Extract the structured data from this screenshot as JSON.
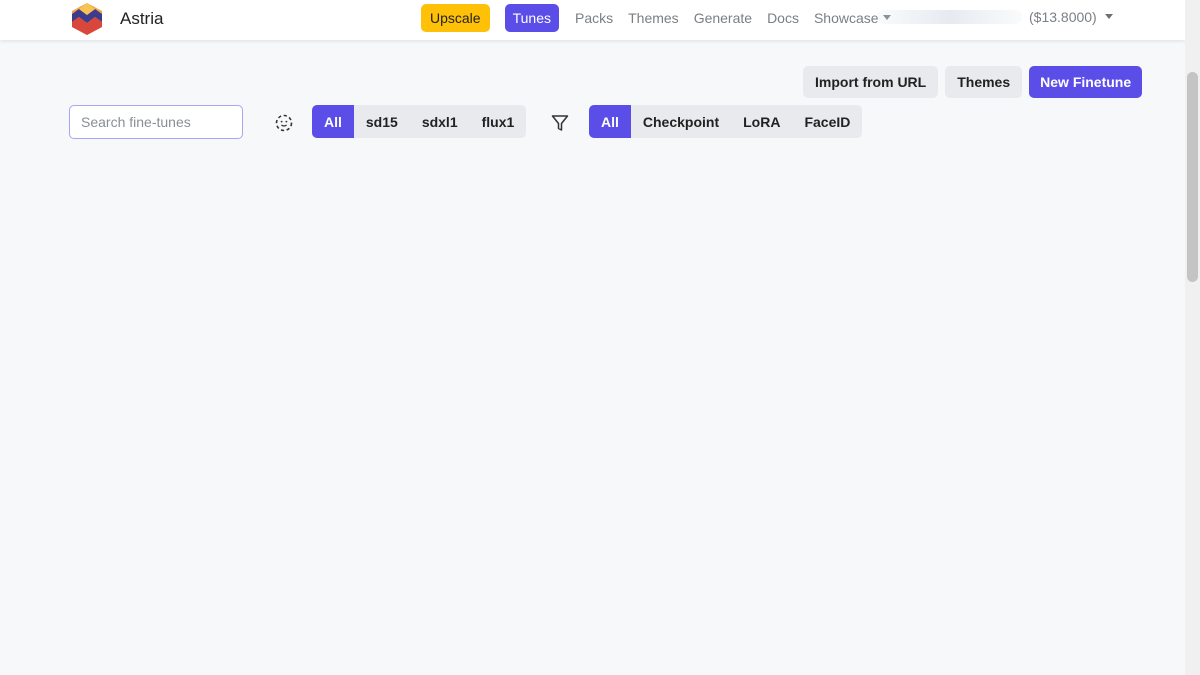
{
  "header": {
    "brand_name": "Astria",
    "upscale_label": "Upscale",
    "tunes_label": "Tunes",
    "nav_links": [
      "Packs",
      "Themes",
      "Generate",
      "Docs",
      "Showcase"
    ],
    "balance": "($13.8000)"
  },
  "actions": {
    "import_label": "Import from URL",
    "themes_label": "Themes",
    "new_finetune_label": "New Finetune"
  },
  "filters": {
    "search_placeholder": "Search fine-tunes",
    "model_options": [
      "All",
      "sd15",
      "sdxl1",
      "flux1"
    ],
    "model_selected": "All",
    "type_options": [
      "All",
      "Checkpoint",
      "LoRA",
      "FaceID"
    ],
    "type_selected": "All"
  },
  "icons": {
    "logo": "astria-logo-icon",
    "focus": "face-focus-icon",
    "filter": "funnel-filter-icon"
  },
  "colors": {
    "accent": "#5b4de8",
    "upscale": "#ffc107",
    "background": "#f7f8fa"
  }
}
